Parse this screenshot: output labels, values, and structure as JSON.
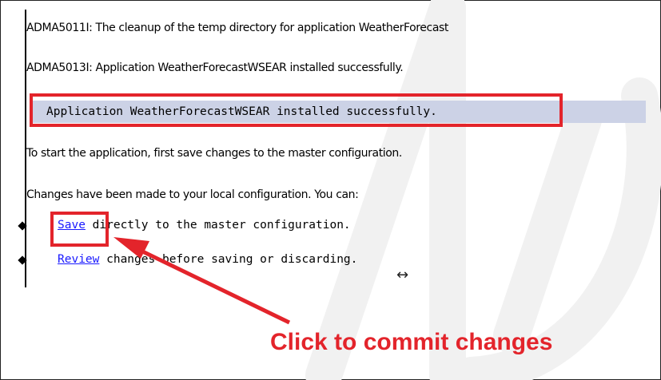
{
  "messages": {
    "cleanup": "ADMA5011I: The cleanup of the temp directory for application WeatherForecast",
    "installed": "ADMA5013I: Application WeatherForecastWSEAR installed successfully."
  },
  "banner": {
    "text": "Application WeatherForecastWSEAR installed successfully."
  },
  "instructions": {
    "start": "To start the application, first save changes to the master configuration.",
    "changes": "Changes have been made to your local configuration. You can:"
  },
  "actions": [
    {
      "link": "Save",
      "rest": " directly to the master configuration."
    },
    {
      "link": "Review",
      "rest": " changes before saving or discarding."
    }
  ],
  "annotation": {
    "callout": "Click to commit changes"
  },
  "colors": {
    "highlight": "#e3242b",
    "banner": "#ccd2e6",
    "link": "#1a1aff"
  }
}
